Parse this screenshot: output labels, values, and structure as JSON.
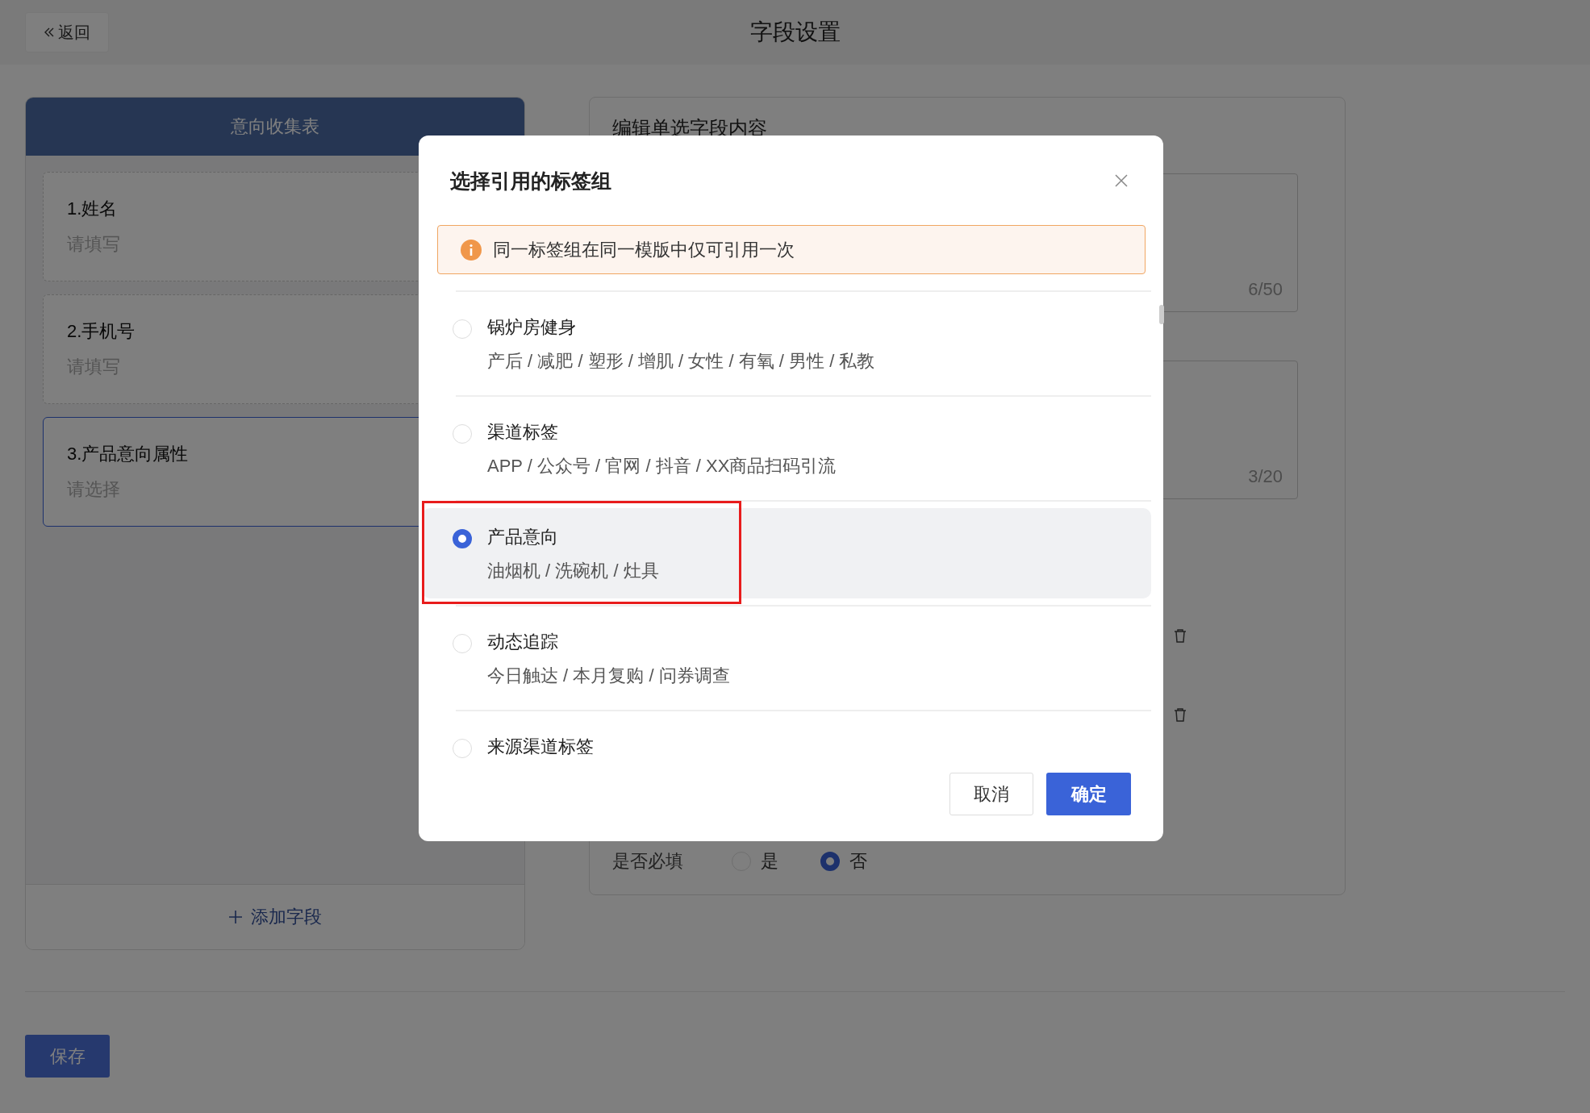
{
  "header": {
    "back_label": "返回",
    "title": "字段设置"
  },
  "form_panel": {
    "title": "意向收集表",
    "fields": [
      {
        "label": "1.姓名",
        "placeholder": "请填写",
        "selected": false
      },
      {
        "label": "2.手机号",
        "placeholder": "请填写",
        "selected": false
      },
      {
        "label": "3.产品意向属性",
        "placeholder": "请选择",
        "selected": true
      }
    ],
    "add_label": "添加字段"
  },
  "save_label": "保存",
  "editor": {
    "title": "编辑单选字段内容",
    "counters": [
      "6/50",
      "3/20"
    ],
    "required": {
      "label": "是否必填",
      "choices": [
        {
          "label": "是",
          "selected": false
        },
        {
          "label": "否",
          "selected": true
        }
      ]
    }
  },
  "dialog": {
    "title": "选择引用的标签组",
    "notice": "同一标签组在同一模版中仅可引用一次",
    "groups": [
      {
        "name": "锅炉房健身",
        "tags": "产后 / 减肥 / 塑形 / 增肌 / 女性 / 有氧 / 男性 / 私教",
        "selected": false
      },
      {
        "name": "渠道标签",
        "tags": "APP / 公众号 / 官网 / 抖音 / XX商品扫码引流",
        "selected": false
      },
      {
        "name": "产品意向",
        "tags": "油烟机 / 洗碗机 / 灶具",
        "selected": true
      },
      {
        "name": "动态追踪",
        "tags": "今日触达 / 本月复购 / 问券调查",
        "selected": false
      },
      {
        "name": "来源渠道标签",
        "selected": false
      }
    ],
    "buttons": [
      {
        "label": "取消",
        "kind": "secondary"
      },
      {
        "label": "确定",
        "kind": "primary"
      }
    ]
  }
}
